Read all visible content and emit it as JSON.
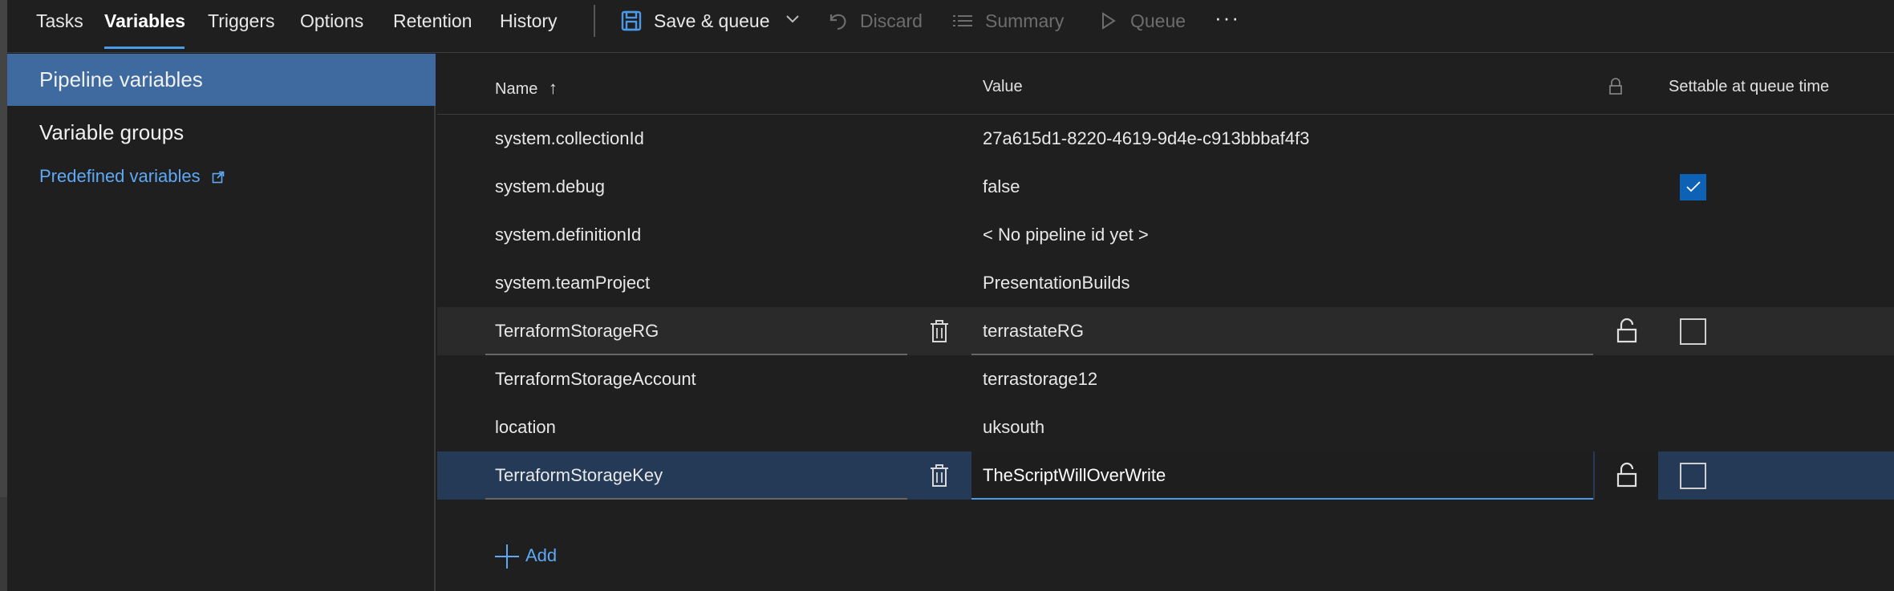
{
  "tabs": [
    {
      "label": "Tasks"
    },
    {
      "label": "Variables"
    },
    {
      "label": "Triggers"
    },
    {
      "label": "Options"
    },
    {
      "label": "Retention"
    },
    {
      "label": "History"
    }
  ],
  "toolbar": {
    "save_queue": "Save & queue",
    "discard": "Discard",
    "summary": "Summary",
    "queue": "Queue",
    "more": "···"
  },
  "leftnav": {
    "pipeline_variables": "Pipeline variables",
    "variable_groups": "Variable groups",
    "predefined_variables": "Predefined variables"
  },
  "grid": {
    "headers": {
      "name": "Name",
      "sort_arrow": "↑",
      "value": "Value",
      "settable": "Settable at queue time"
    },
    "rows": [
      {
        "name": "system.collectionId",
        "value": "27a615d1-8220-4619-9d4e-c913bbbaf4f3"
      },
      {
        "name": "system.debug",
        "value": "false",
        "settable": true
      },
      {
        "name": "system.definitionId",
        "value": "< No pipeline id yet >"
      },
      {
        "name": "system.teamProject",
        "value": "PresentationBuilds"
      },
      {
        "name": "TerraformStorageRG",
        "value": "terrastateRG",
        "settable": false
      },
      {
        "name": "TerraformStorageAccount",
        "value": "terrastorage12"
      },
      {
        "name": "location",
        "value": "uksouth"
      },
      {
        "name": "TerraformStorageKey",
        "value": "TheScriptWillOverWrite",
        "settable": false
      }
    ],
    "add_label": "Add"
  },
  "colors": {
    "accent": "#4a9ae8",
    "link": "#5ea9f5",
    "selected_nav": "#3e6a9f",
    "selected_row": "#243a57",
    "checkbox_checked": "#0e62b6"
  },
  "icons": [
    "save-icon",
    "chevron-down-icon",
    "undo-icon",
    "list-icon",
    "play-icon",
    "more-icon",
    "external-link-icon",
    "sort-up-icon",
    "lock-icon",
    "trash-icon",
    "unlock-icon",
    "checkmark-icon",
    "plus-icon"
  ]
}
